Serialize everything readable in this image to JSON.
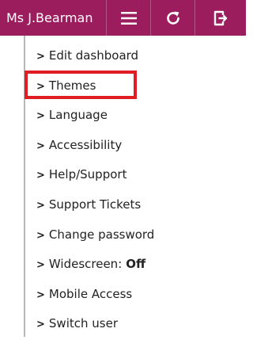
{
  "topbar": {
    "user_name": "Ms J.Bearman",
    "buttons": [
      {
        "name": "menu",
        "icon": "hamburger-menu-icon"
      },
      {
        "name": "refresh",
        "icon": "refresh-icon"
      },
      {
        "name": "logout",
        "icon": "logout-icon"
      }
    ],
    "color": "#9c1d5e"
  },
  "menu": {
    "items": [
      {
        "label": "Edit dashboard"
      },
      {
        "label": "Themes",
        "highlighted": true
      },
      {
        "label": "Language"
      },
      {
        "label": "Accessibility"
      },
      {
        "label": "Help/Support"
      },
      {
        "label": "Support Tickets"
      },
      {
        "label": "Change password"
      },
      {
        "label": "Widescreen:",
        "value": "Off"
      },
      {
        "label": "Mobile Access"
      },
      {
        "label": "Switch user"
      }
    ],
    "chevron": ">"
  },
  "highlight_color": "#e01c24"
}
